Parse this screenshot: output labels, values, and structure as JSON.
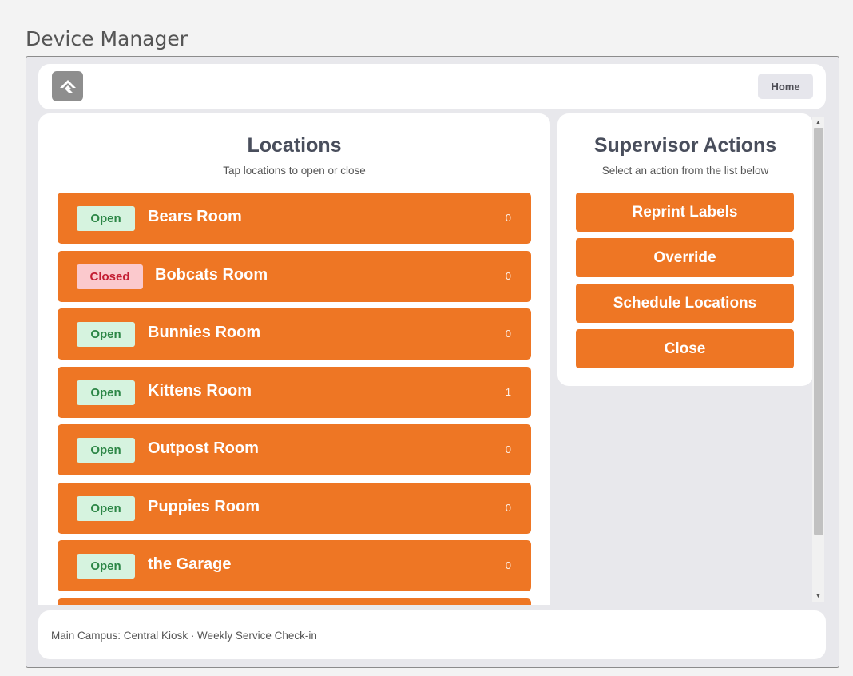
{
  "page": {
    "title": "Device Manager"
  },
  "header": {
    "logo_icon": "rock-logo-icon",
    "home_label": "Home"
  },
  "locations": {
    "title": "Locations",
    "subtitle": "Tap locations to open or close",
    "items": [
      {
        "status": "Open",
        "name": "Bears Room",
        "count": "0"
      },
      {
        "status": "Closed",
        "name": "Bobcats Room",
        "count": "0"
      },
      {
        "status": "Open",
        "name": "Bunnies Room",
        "count": "0"
      },
      {
        "status": "Open",
        "name": "Kittens Room",
        "count": "1"
      },
      {
        "status": "Open",
        "name": "Outpost Room",
        "count": "0"
      },
      {
        "status": "Open",
        "name": "Puppies Room",
        "count": "0"
      },
      {
        "status": "Open",
        "name": "the Garage",
        "count": "0"
      }
    ]
  },
  "supervisor": {
    "title": "Supervisor Actions",
    "subtitle": "Select an action from the list below",
    "actions": [
      "Reprint Labels",
      "Override",
      "Schedule Locations",
      "Close"
    ]
  },
  "footer": {
    "text": "Main Campus: Central Kiosk · Weekly Service Check-in"
  },
  "colors": {
    "accent": "#ee7624",
    "open_badge_bg": "#d6f3df",
    "open_badge_text": "#2c8646",
    "closed_badge_bg": "#fbc9cd",
    "closed_badge_text": "#c31e33"
  }
}
